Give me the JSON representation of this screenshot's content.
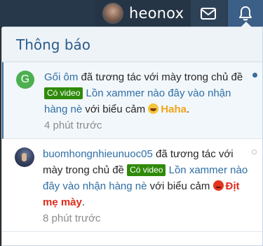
{
  "nav": {
    "username": "heonox",
    "mail_icon": "envelope-icon",
    "bell_icon": "bell-icon"
  },
  "panel": {
    "title": "Thông báo"
  },
  "notifications": [
    {
      "avatar_letter": "G",
      "actor": "Gối ôm",
      "text1": " đã tương tác với mày trong chủ đề ",
      "prefix": "Có video",
      "thread": "Lồn xammer nào đây vào nhận hàng nè",
      "text2": " với biểu cảm ",
      "reaction": "Haha",
      "end": ".",
      "time": "4 phút trước"
    },
    {
      "actor": "buomhongnhieunuoc05",
      "text1": " đã tương tác với mày trong chủ đề ",
      "prefix": "Có video",
      "thread": "Lồn xammer nào đây vào nhận hàng nè",
      "text2": " với biểu cảm ",
      "reaction": "Địt mẹ mày",
      "end": ".",
      "time": "8 phút trước"
    }
  ],
  "colors": {
    "accent": "#2f6ea5",
    "prefix_bg": "#2f8a0a",
    "haha": "#f0a51c",
    "angry": "#e02a1c"
  }
}
